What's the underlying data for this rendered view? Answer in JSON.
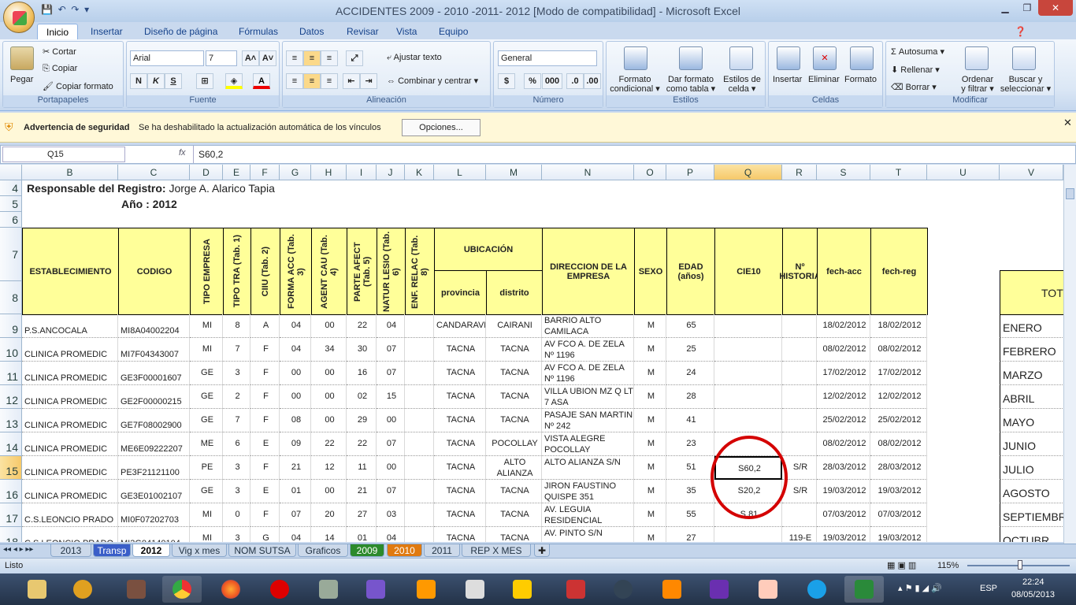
{
  "window": {
    "title": "ACCIDENTES   2009 - 2010 -2011- 2012  [Modo de compatibilidad] - Microsoft Excel"
  },
  "tabs": [
    "Inicio",
    "Insertar",
    "Diseño de página",
    "Fórmulas",
    "Datos",
    "Revisar",
    "Vista",
    "Equipo"
  ],
  "ribbon": {
    "portapapeles": {
      "label": "Portapapeles",
      "pegar": "Pegar",
      "cortar": "Cortar",
      "copiar": "Copiar",
      "copiar_formato": "Copiar formato"
    },
    "fuente": {
      "label": "Fuente",
      "font": "Arial",
      "size": "7"
    },
    "alineacion": {
      "label": "Alineación",
      "ajustar": "Ajustar texto",
      "combinar": "Combinar y centrar"
    },
    "numero": {
      "label": "Número",
      "format": "General",
      "pct": "%",
      "thousands": "000"
    },
    "estilos": {
      "label": "Estilos",
      "formato_condicional_1": "Formato",
      "formato_condicional_2": "condicional",
      "dar_formato_1": "Dar formato",
      "dar_formato_2": "como tabla",
      "estilos_celda_1": "Estilos de",
      "estilos_celda_2": "celda"
    },
    "celdas": {
      "label": "Celdas",
      "insertar": "Insertar",
      "eliminar": "Eliminar",
      "formato": "Formato"
    },
    "modificar": {
      "label": "Modificar",
      "autosuma": "Autosuma",
      "rellenar": "Rellenar",
      "borrar": "Borrar",
      "ordenar_1": "Ordenar",
      "ordenar_2": "y filtrar",
      "buscar_1": "Buscar y",
      "buscar_2": "seleccionar"
    }
  },
  "security": {
    "title": "Advertencia de seguridad",
    "message": "Se ha deshabilitado la actualización automática de los vínculos",
    "button": "Opciones..."
  },
  "formula": {
    "namebox": "Q15",
    "fx": "fx",
    "value": "S60,2"
  },
  "columns": [
    "B",
    "C",
    "D",
    "E",
    "F",
    "G",
    "H",
    "I",
    "J",
    "K",
    "L",
    "M",
    "N",
    "O",
    "P",
    "Q",
    "R",
    "S",
    "T",
    "U",
    "V"
  ],
  "rows": [
    "4",
    "5",
    "6",
    "7",
    "8",
    "9",
    "10",
    "11",
    "12",
    "13",
    "14",
    "15",
    "16",
    "17",
    "18"
  ],
  "sheet": {
    "responsable_label": "Responsable del Registro:",
    "responsable_name": " Jorge A. Alarico Tapia",
    "anio": "Año  : 2012",
    "headers": {
      "establecimiento": "ESTABLECIMIENTO",
      "codigo": "CODIGO",
      "tipo_empresa": "TIPO EMPRESA",
      "tipo_tra": "TIPO TRA (Tab. 1)",
      "ciiu": "CIIU (Tab. 2)",
      "forma_acc": "FORMA ACC (Tab. 3)",
      "agent_cau": "AGENT CAU (Tab. 4)",
      "parte_afect": "PARTE AFECT (Tab. 5)",
      "natur_lesio": "NATUR LESIO (Tab. 6)",
      "enf_relac": "ENF. RELAC (Tab. 8)",
      "ubicacion": "UBICACIÓN",
      "provincia": "provincia",
      "distrito": "distrito",
      "direccion": "DIRECCION DE LA EMPRESA",
      "sexo": "SEXO",
      "edad": "EDAD (años)",
      "cie10": "CIE10",
      "historia": "Nº HISTORIA",
      "fech_acc": "fech-acc",
      "fech_reg": "fech-reg",
      "tot": "TOT"
    },
    "data": [
      [
        "P.S.ANCOCALA",
        "MI8A04002204",
        "MI",
        "8",
        "A",
        "04",
        "00",
        "22",
        "04",
        "",
        "CANDARAVE",
        "CAIRANI",
        "BARRIO ALTO CAMILACA",
        "M",
        "65",
        "",
        "",
        "18/02/2012",
        "18/02/2012"
      ],
      [
        "CLINICA PROMEDIC",
        "MI7F04343007",
        "MI",
        "7",
        "F",
        "04",
        "34",
        "30",
        "07",
        "",
        "TACNA",
        "TACNA",
        "AV FCO A. DE ZELA Nº 1196",
        "M",
        "25",
        "",
        "",
        "08/02/2012",
        "08/02/2012"
      ],
      [
        "CLINICA PROMEDIC",
        "GE3F00001607",
        "GE",
        "3",
        "F",
        "00",
        "00",
        "16",
        "07",
        "",
        "TACNA",
        "TACNA",
        "AV FCO A. DE ZELA Nº 1196",
        "M",
        "24",
        "",
        "",
        "17/02/2012",
        "17/02/2012"
      ],
      [
        "CLINICA PROMEDIC",
        "GE2F00000215",
        "GE",
        "2",
        "F",
        "00",
        "00",
        "02",
        "15",
        "",
        "TACNA",
        "TACNA",
        "VILLA UBION MZ Q LT 7 ASA",
        "M",
        "28",
        "",
        "",
        "12/02/2012",
        "12/02/2012"
      ],
      [
        "CLINICA PROMEDIC",
        "GE7F08002900",
        "GE",
        "7",
        "F",
        "08",
        "00",
        "29",
        "00",
        "",
        "TACNA",
        "TACNA",
        "PASAJE SAN MARTIN Nº 242",
        "M",
        "41",
        "",
        "",
        "25/02/2012",
        "25/02/2012"
      ],
      [
        "CLINICA PROMEDIC",
        "ME6E09222207",
        "ME",
        "6",
        "E",
        "09",
        "22",
        "22",
        "07",
        "",
        "TACNA",
        "POCOLLAY",
        "VISTA ALEGRE POCOLLAY",
        "M",
        "23",
        "",
        "",
        "08/02/2012",
        "08/02/2012"
      ],
      [
        "CLINICA PROMEDIC",
        "PE3F21121100",
        "PE",
        "3",
        "F",
        "21",
        "12",
        "11",
        "00",
        "",
        "TACNA",
        "ALTO ALIANZA",
        "ALTO ALIANZA S/N",
        "M",
        "51",
        "S60,2",
        "S/R",
        "28/03/2012",
        "28/03/2012"
      ],
      [
        "CLINICA PROMEDIC",
        "GE3E01002107",
        "GE",
        "3",
        "E",
        "01",
        "00",
        "21",
        "07",
        "",
        "TACNA",
        "TACNA",
        "JIRON FAUSTINO QUISPE 351",
        "M",
        "35",
        "S20,2",
        "S/R",
        "19/03/2012",
        "19/03/2012"
      ],
      [
        "C.S.LEONCIO PRADO",
        "MI0F07202703",
        "MI",
        "0",
        "F",
        "07",
        "20",
        "27",
        "03",
        "",
        "TACNA",
        "TACNA",
        "AV. LEGUIA RESIDENCIAL",
        "M",
        "55",
        "S,81",
        "",
        "07/03/2012",
        "07/03/2012"
      ],
      [
        "C.S.LEONCIO PRADO",
        "MI3G04140104",
        "MI",
        "3",
        "G",
        "04",
        "14",
        "01",
        "04",
        "",
        "TACNA",
        "TACNA",
        "AV. PINTO S/N",
        "M",
        "27",
        "",
        "119-E",
        "19/03/2012",
        "19/03/2012"
      ]
    ],
    "months": [
      "ENERO",
      "FEBRERO",
      "MARZO",
      "ABRIL",
      "MAYO",
      "JUNIO",
      "JULIO",
      "AGOSTO",
      "SEPTIEMBR",
      "OCTUBR"
    ]
  },
  "sheet_tabs": [
    "2013",
    "Transp",
    "2012",
    "Vig x mes",
    "NOM SUTSA",
    "Graficos",
    "2009",
    "2010",
    "2011",
    "REP X MES"
  ],
  "status": {
    "ready": "Listo",
    "zoom": "115%"
  },
  "taskbar": {
    "lang": "ESP",
    "time": "22:24",
    "date": "08/05/2013"
  }
}
